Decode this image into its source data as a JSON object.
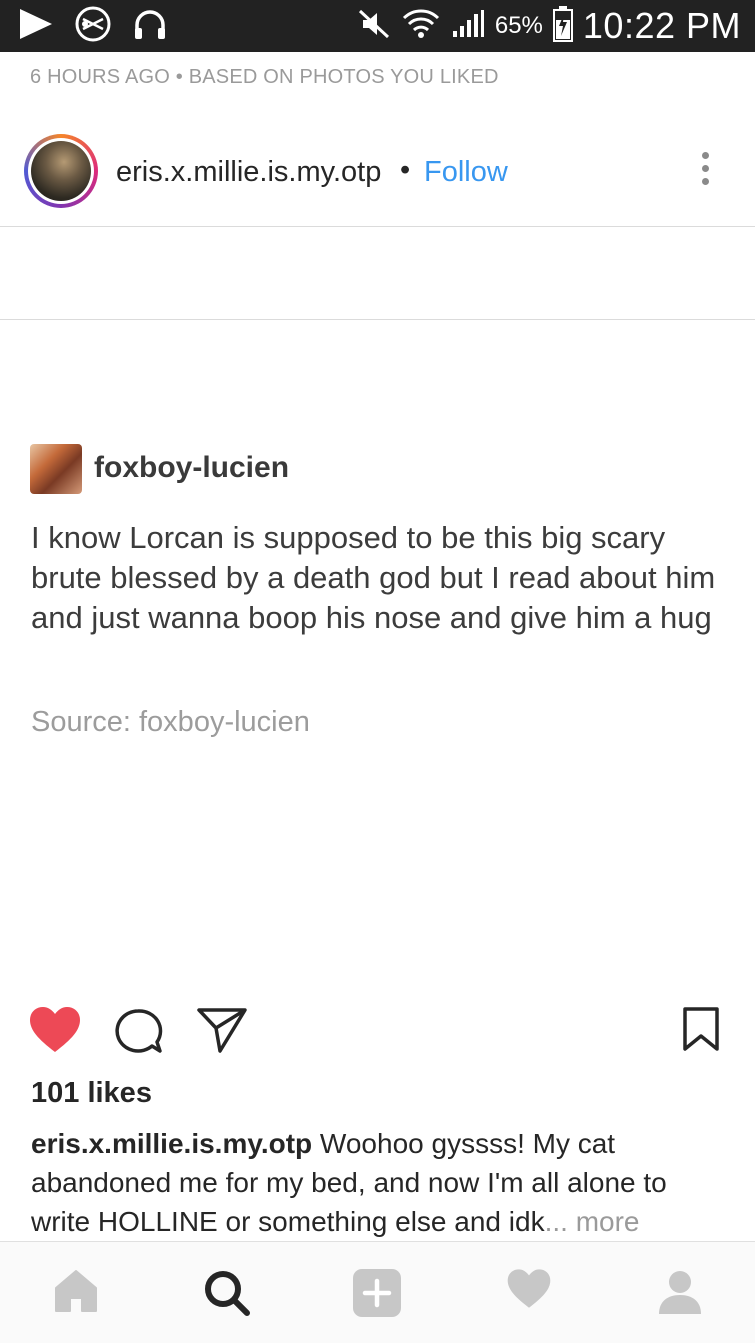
{
  "status_bar": {
    "battery_percent": "65%",
    "time": "10:22 PM"
  },
  "context_line": "6 HOURS AGO • BASED ON PHOTOS YOU LIKED",
  "post": {
    "username": "eris.x.millie.is.my.otp",
    "separator": "•",
    "follow_label": "Follow"
  },
  "tumblr": {
    "username": "foxboy-lucien",
    "text": "I know Lorcan is supposed to be this big scary brute blessed by a death god but I read about him and just wanna boop his nose and give him a hug",
    "source": "Source: foxboy-lucien"
  },
  "engagement": {
    "likes": "101 likes",
    "caption_user": "eris.x.millie.is.my.otp",
    "caption_text": " Woohoo gyssss! My cat abandoned me for my bed, and now I'm all alone to write HOLLINE or something else and idk",
    "caption_more": "... more"
  },
  "colors": {
    "like_red": "#ed4956",
    "follow_blue": "#3897f0",
    "status_bar_bg": "#222222"
  },
  "icons": {
    "status_left": [
      "play-icon",
      "scissors-badge-icon",
      "headphones-icon"
    ],
    "status_right": [
      "mute-icon",
      "wifi-icon",
      "signal-icon",
      "battery-icon"
    ],
    "actions": [
      "heart-filled-icon",
      "comment-icon",
      "share-icon",
      "bookmark-icon"
    ],
    "nav": [
      "home-icon",
      "search-icon",
      "add-icon",
      "activity-heart-icon",
      "profile-icon"
    ]
  }
}
